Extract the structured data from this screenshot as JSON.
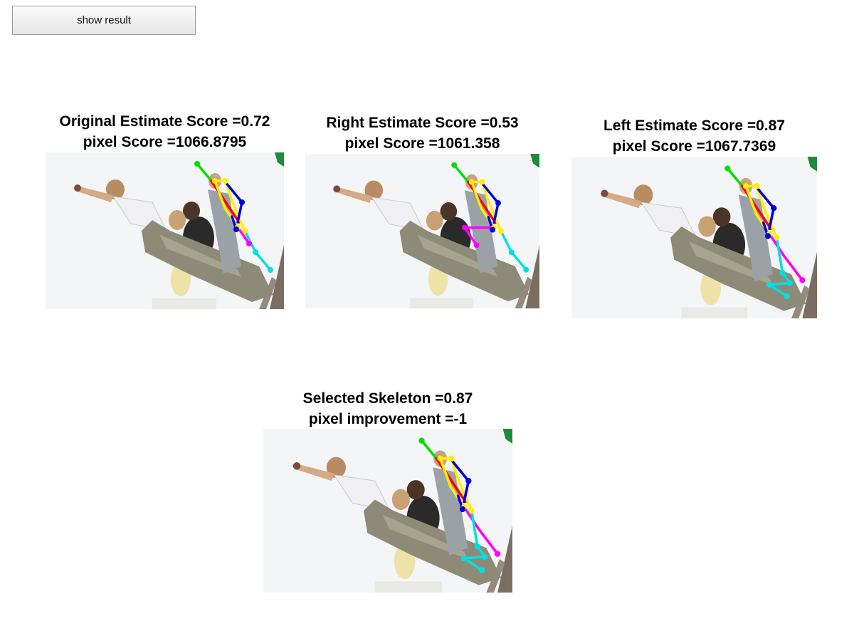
{
  "button": {
    "label": "show result"
  },
  "panels": [
    {
      "title": "Original Estimate Score =0.72",
      "subtitle": "pixel Score =1066.8795"
    },
    {
      "title": "Right Estimate Score =0.53",
      "subtitle": "pixel Score =1061.358"
    },
    {
      "title": "Left Estimate Score =0.87",
      "subtitle": "pixel Score =1067.7369"
    },
    {
      "title": "Selected Skeleton =0.87",
      "subtitle": "pixel improvement =-1"
    }
  ],
  "colors": {
    "head": "#00e000",
    "torso": "#ff0000",
    "arm_right": "#ffee00",
    "arm_left": "#0000dd",
    "leg_a": "#ff00ff",
    "leg_b": "#00e0e0"
  }
}
